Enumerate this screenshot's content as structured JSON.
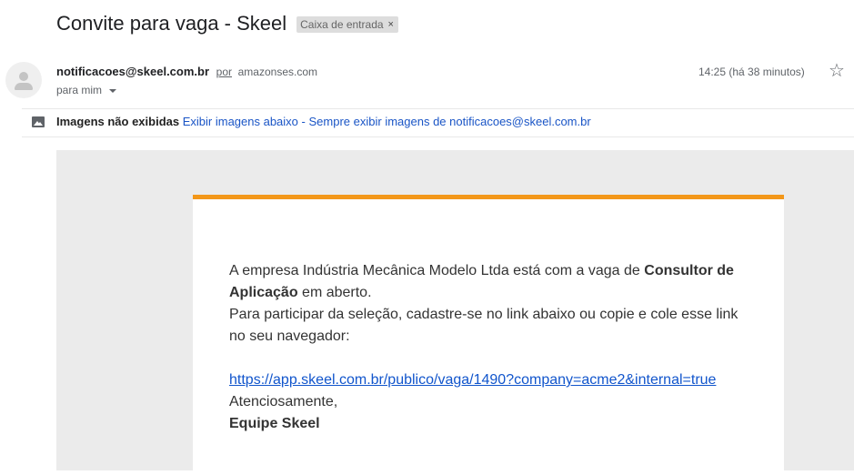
{
  "subject": "Convite para vaga - Skeel",
  "label": {
    "text": "Caixa de entrada",
    "remove": "×"
  },
  "sender": {
    "email": "notificacoes@skeel.com.br",
    "via_label": "por",
    "via_domain": "amazonses.com",
    "to": "para mim",
    "time": "14:25 (há 38 minutos)"
  },
  "images_bar": {
    "notice": "Imagens não exibidas",
    "show_below": "Exibir imagens abaixo",
    "separator": "-",
    "always_show": "Sempre exibir imagens de notificacoes@skeel.com.br"
  },
  "body": {
    "intro_before": "A empresa Indústria Mecânica Modelo Ltda está com a vaga de ",
    "job_title": "Consultor de Aplicação",
    "intro_after": " em aberto.",
    "instruction": "Para participar da seleção, cadastre-se no link abaixo ou copie e cole esse link no seu navegador:",
    "link": "https://app.skeel.com.br/publico/vaga/1490?company=acme2&internal=true",
    "regards": "Atenciosamente,",
    "team": "Equipe Skeel"
  },
  "colors": {
    "accent_bar": "#f39719",
    "link": "#1155cc"
  },
  "icons": {
    "avatar": "person-avatar-icon",
    "star": "star-icon",
    "image": "image-icon",
    "caret": "chevron-down-icon"
  }
}
